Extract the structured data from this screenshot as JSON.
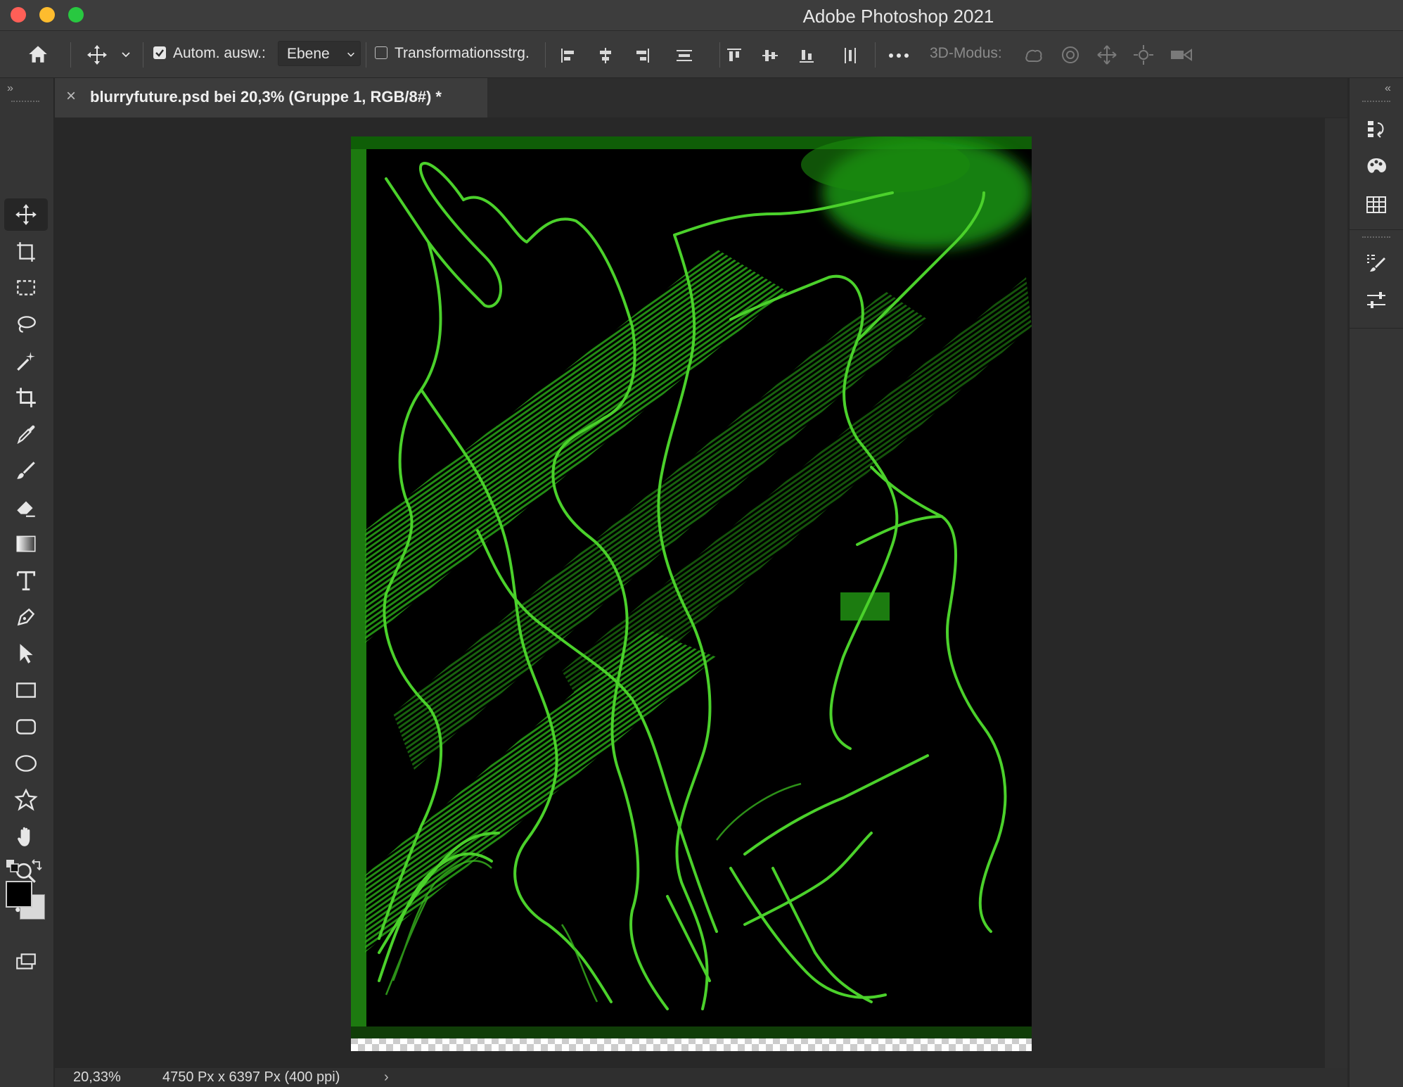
{
  "window": {
    "title": "Adobe Photoshop 2021"
  },
  "options_bar": {
    "auto_select_label": "Autom. ausw.:",
    "auto_select_checked": true,
    "auto_select_target": "Ebene",
    "transform_controls_label": "Transformationsstrg.",
    "transform_controls_checked": false,
    "mode_3d_label": "3D-Modus:"
  },
  "document": {
    "tab_title": "blurryfuture.psd bei 20,3% (Gruppe 1, RGB/8#) *",
    "zoom": "20,33%",
    "dimensions": "4750 Px x 6397 Px (400 ppi)"
  },
  "tools": [
    {
      "name": "move-tool-icon",
      "active": true
    },
    {
      "name": "artboard-tool-icon"
    },
    {
      "name": "rectangular-marquee-icon"
    },
    {
      "name": "lasso-icon"
    },
    {
      "name": "magic-wand-icon"
    },
    {
      "name": "crop-icon"
    },
    {
      "name": "eyedropper-icon"
    },
    {
      "name": "brush-icon"
    },
    {
      "name": "eraser-icon"
    },
    {
      "name": "gradient-icon"
    },
    {
      "name": "type-icon"
    },
    {
      "name": "pen-icon"
    },
    {
      "name": "path-selection-icon"
    },
    {
      "name": "rectangle-icon"
    },
    {
      "name": "rounded-rectangle-icon"
    },
    {
      "name": "ellipse-icon"
    },
    {
      "name": "custom-shape-icon"
    },
    {
      "name": "hand-icon"
    },
    {
      "name": "zoom-icon"
    },
    {
      "name": "more-tools-icon"
    }
  ],
  "colors": {
    "foreground": "#000000",
    "background": "#d9d9d9",
    "artwork_line": "#4bd12b",
    "artwork_band": "#1f8a12"
  }
}
